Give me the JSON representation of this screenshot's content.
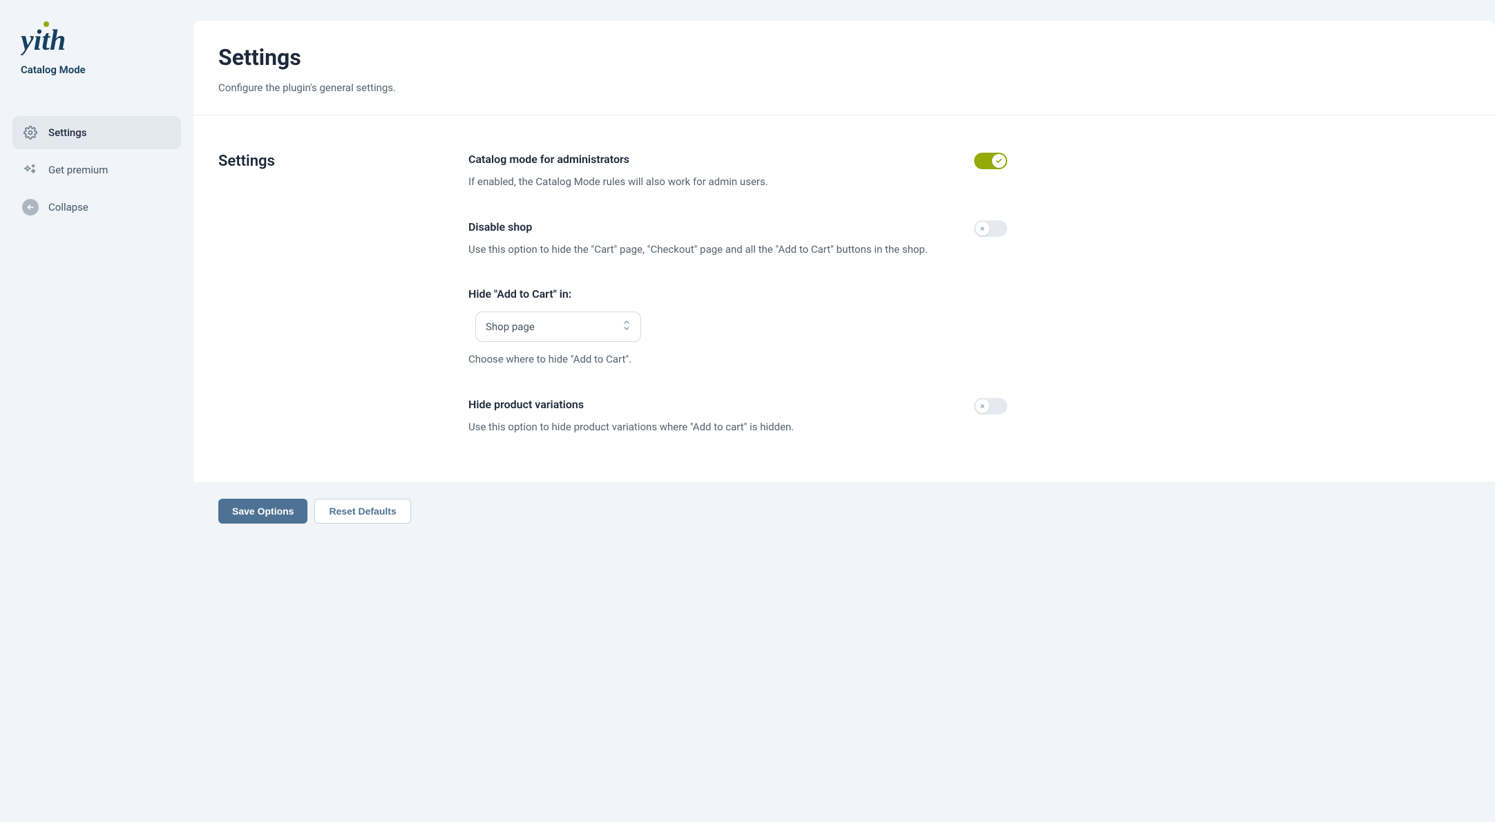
{
  "brand": {
    "plugin_name": "Catalog Mode"
  },
  "sidebar": {
    "items": [
      {
        "label": "Settings"
      },
      {
        "label": "Get premium"
      },
      {
        "label": "Collapse"
      }
    ]
  },
  "header": {
    "title": "Settings",
    "subtitle": "Configure the plugin's general settings."
  },
  "section": {
    "heading": "Settings"
  },
  "settings": {
    "admin_mode": {
      "title": "Catalog mode for administrators",
      "description": "If enabled, the Catalog Mode rules will also work for admin users.",
      "enabled": true
    },
    "disable_shop": {
      "title": "Disable shop",
      "description": "Use this option to hide the \"Cart\" page, \"Checkout\" page and all the \"Add to Cart\" buttons in the shop.",
      "enabled": false
    },
    "hide_add_to_cart": {
      "title": "Hide \"Add to Cart\" in:",
      "selected": "Shop page",
      "help": "Choose where to hide \"Add to Cart\"."
    },
    "hide_variations": {
      "title": "Hide product variations",
      "description": "Use this option to hide product variations where \"Add to cart\" is hidden.",
      "enabled": false
    }
  },
  "footer": {
    "save_label": "Save Options",
    "reset_label": "Reset Defaults"
  }
}
